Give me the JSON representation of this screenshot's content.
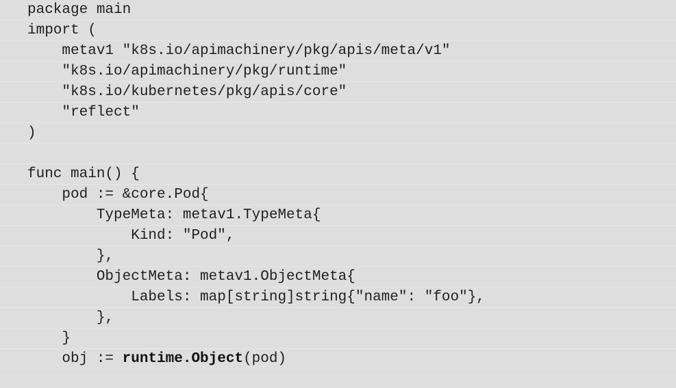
{
  "code": {
    "lines": [
      "package main",
      "import (",
      "    metav1 \"k8s.io/apimachinery/pkg/apis/meta/v1\"",
      "    \"k8s.io/apimachinery/pkg/runtime\"",
      "    \"k8s.io/kubernetes/pkg/apis/core\"",
      "    \"reflect\"",
      ")",
      "",
      "func main() {",
      "    pod := &core.Pod{",
      "        TypeMeta: metav1.TypeMeta{",
      "            Kind: \"Pod\",",
      "        },",
      "        ObjectMeta: metav1.ObjectMeta{",
      "            Labels: map[string]string{\"name\": \"foo\"},",
      "        },",
      "    }"
    ],
    "last_line": {
      "prefix": "    obj := ",
      "bold": "runtime.Object",
      "suffix": "(pod)"
    }
  }
}
